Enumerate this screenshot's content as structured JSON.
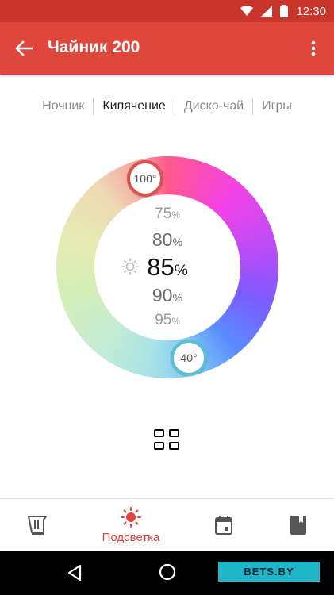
{
  "status_bar": {
    "time": "12:30"
  },
  "app_bar": {
    "title": "Чайник 200"
  },
  "mode_tabs": [
    {
      "label": "Ночник",
      "active": false
    },
    {
      "label": "Кипячение",
      "active": true
    },
    {
      "label": "Диско-чай",
      "active": false
    },
    {
      "label": "Игры",
      "active": false
    }
  ],
  "color_wheel": {
    "handle_top": "100°",
    "handle_bottom": "40°",
    "percent_options": [
      {
        "value": "75",
        "unit": "%"
      },
      {
        "value": "80",
        "unit": "%"
      },
      {
        "value": "85",
        "unit": "%"
      },
      {
        "value": "90",
        "unit": "%"
      },
      {
        "value": "95",
        "unit": "%"
      }
    ],
    "selected_percent": "85"
  },
  "bottom_nav": {
    "items": [
      {
        "icon": "teapot-icon",
        "label": ""
      },
      {
        "icon": "sun-icon",
        "label": "Подсветка",
        "active": true
      },
      {
        "icon": "calendar-icon",
        "label": ""
      },
      {
        "icon": "book-icon",
        "label": ""
      }
    ]
  },
  "watermark": {
    "text": "BETS.BY"
  },
  "colors": {
    "accent": "#e0473c",
    "status_bar": "#c9352b",
    "handle_hot": "#d9534f",
    "handle_cold": "#5bbfd0"
  }
}
